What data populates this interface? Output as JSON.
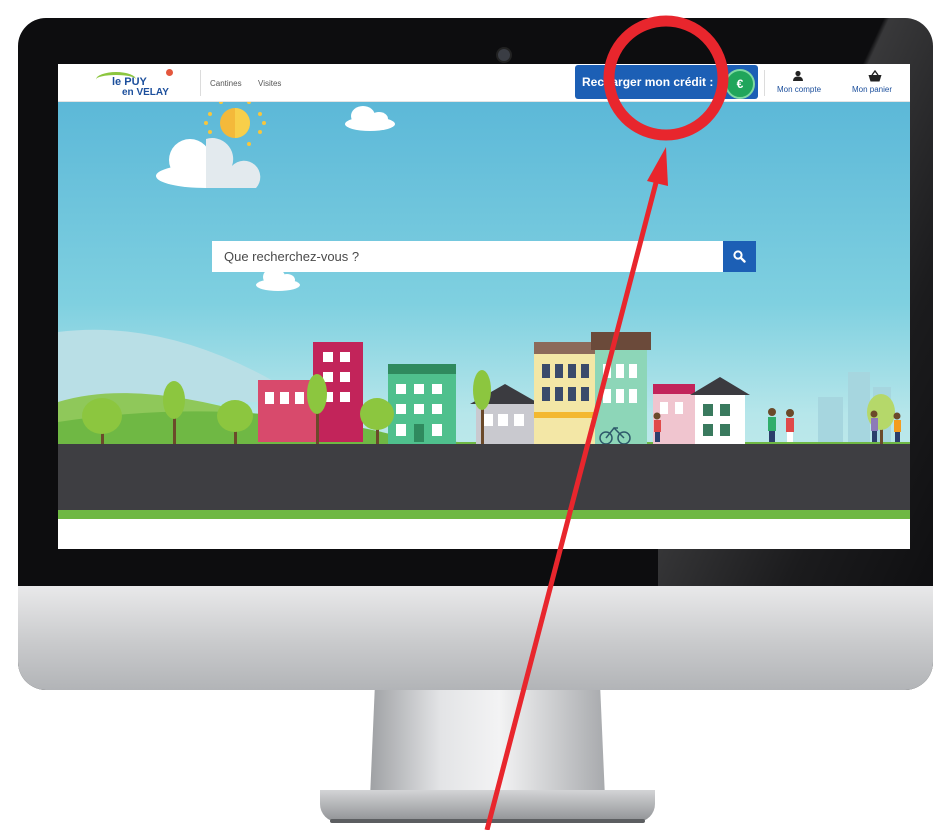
{
  "nav": {
    "logo_line1": "le PUY",
    "logo_line2": "en VELAY",
    "links": [
      "Cantines",
      "Visites"
    ],
    "recharge_label": "Recharger mon crédit :",
    "euro_symbol": "€",
    "account_label": "Mon compte",
    "cart_label": "Mon panier"
  },
  "search": {
    "placeholder": "Que recherchez-vous ?"
  },
  "icons": {
    "search": "search-icon",
    "account": "user-icon",
    "cart": "basket-icon",
    "credit": "euro-coin-icon"
  },
  "colors": {
    "brand_blue": "#1c5fb5",
    "sky": "#5cb8d8",
    "road": "#3e3e42",
    "grass": "#6fb844",
    "annotation_red": "#e8262d"
  }
}
